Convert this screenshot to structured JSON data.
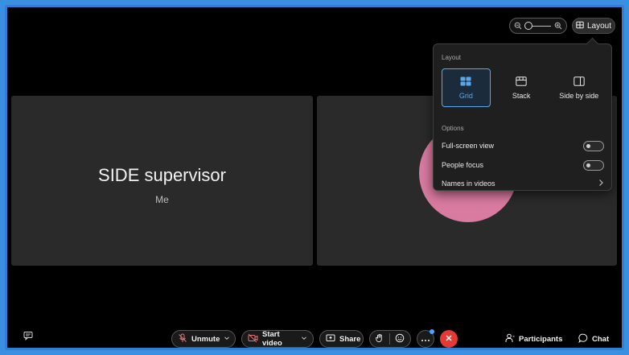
{
  "top_bar": {
    "layout_button_label": "Layout"
  },
  "tiles": {
    "self_name": "SIDE supervisor",
    "self_subtitle": "Me",
    "other_avatar_color": "#d97aa0"
  },
  "layout_panel": {
    "heading": "Layout",
    "options": [
      {
        "label": "Grid",
        "icon": "grid-icon",
        "selected": true
      },
      {
        "label": "Stack",
        "icon": "stack-icon",
        "selected": false
      },
      {
        "label": "Side by side",
        "icon": "side-by-side-icon",
        "selected": false
      }
    ],
    "options_heading": "Options",
    "toggles": [
      {
        "label": "Full-screen view",
        "on": false
      },
      {
        "label": "People focus",
        "on": false
      }
    ],
    "names_in_videos_label": "Names in videos"
  },
  "bottom_bar": {
    "unmute_label": "Unmute",
    "start_video_label": "Start video",
    "share_label": "Share",
    "participants_label": "Participants",
    "chat_label": "Chat"
  },
  "colors": {
    "accent": "#5aa7ea",
    "end_call": "#e53935",
    "muted_icon": "#e57373"
  }
}
